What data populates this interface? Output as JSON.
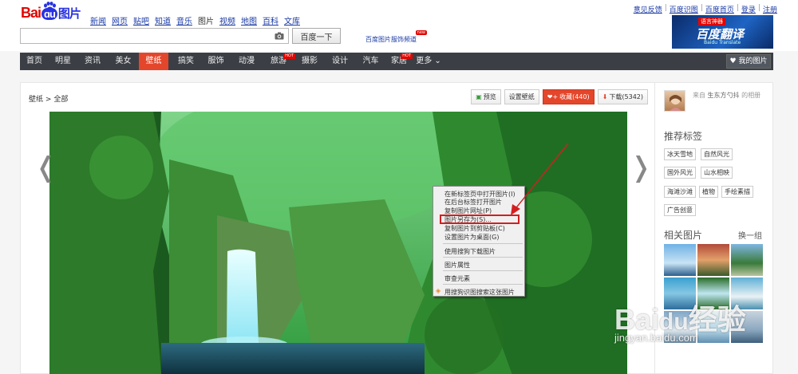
{
  "logo": {
    "bai": "Bai",
    "du": "du",
    "pic": "图片"
  },
  "topnav": [
    {
      "label": "新闻"
    },
    {
      "label": "网页"
    },
    {
      "label": "贴吧"
    },
    {
      "label": "知道"
    },
    {
      "label": "音乐"
    },
    {
      "label": "图片",
      "current": true
    },
    {
      "label": "视频"
    },
    {
      "label": "地图"
    },
    {
      "label": "百科"
    },
    {
      "label": "文库"
    }
  ],
  "search": {
    "value": "",
    "button": "百度一下"
  },
  "promo": {
    "text": "百度图片服饰频道",
    "badge": "new"
  },
  "toplinks": {
    "feedback": "意见反馈",
    "shitu": "百度识图",
    "home": "百度首页",
    "login": "登录",
    "register": "注册"
  },
  "ad": {
    "tag": "语言神器",
    "title": "百度翻译",
    "sub": "Baidu Translate"
  },
  "mainnav": {
    "items": [
      {
        "label": "首页"
      },
      {
        "label": "明星"
      },
      {
        "label": "资讯"
      },
      {
        "label": "美女"
      },
      {
        "label": "壁纸",
        "active": true
      },
      {
        "label": "搞笑"
      },
      {
        "label": "服饰"
      },
      {
        "label": "动漫"
      },
      {
        "label": "旅游",
        "hot": "HOT"
      },
      {
        "label": "摄影"
      },
      {
        "label": "设计"
      },
      {
        "label": "汽车"
      },
      {
        "label": "家居",
        "hot": "HOT"
      },
      {
        "label": "更多"
      }
    ],
    "my_images": "我的图片"
  },
  "breadcrumb": {
    "section": "壁纸",
    "sep": ">",
    "current": "全部"
  },
  "actions": {
    "preview": "预览",
    "set_wallpaper": "设置壁纸",
    "favorite": "收藏(440)",
    "download": "下载(5342)"
  },
  "context_menu": [
    "在新标签页中打开图片(I)",
    "在后台标签打开图片",
    "复制图片网址(P)",
    "图片另存为(S)...",
    "复制图片到剪贴板(C)",
    "设置图片为桌面(G)",
    "使用搜狗下载图片",
    "图片属性",
    "审查元素",
    "用搜狗识图搜索这张图片"
  ],
  "context_menu_highlight": "图片另存为(S)...",
  "sidebar": {
    "from_prefix": "来自",
    "author": "生东方勺抖",
    "from_suffix": "的相册",
    "recommended_title": "推荐标签",
    "tags": [
      "冰天雪地",
      "自然风光",
      "国外风光",
      "山水相映",
      "海滩沙滩",
      "植物",
      "手绘素描",
      "广告创意"
    ],
    "related_title": "相关图片",
    "change_group": "换一组"
  },
  "watermark": {
    "brand": "Bai",
    "suffix": "经验",
    "url": "jingyan.baidu.com"
  },
  "colors": {
    "brand_red": "#e10601",
    "brand_blue": "#2932e1",
    "nav_bg": "#3b3f45",
    "nav_active": "#e4462b",
    "menu_highlight": "#d31f1f"
  }
}
